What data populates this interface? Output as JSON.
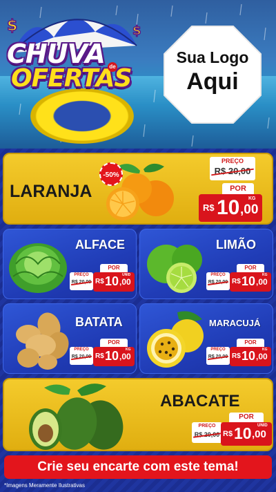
{
  "header": {
    "title_line1": "CHUVA",
    "title_de": "de",
    "title_line2": "OFERTAS",
    "logo_line1": "Sua Logo",
    "logo_line2": "Aqui"
  },
  "products": [
    {
      "name": "LARANJA",
      "discount": "-50%",
      "old_label": "PREÇO",
      "old_price": "R$ 20,00",
      "por_label": "POR",
      "currency": "R$",
      "price_int": "10",
      "price_dec": ",00",
      "unit": "KG"
    },
    {
      "name": "ALFACE",
      "old_label": "PREÇO",
      "old_price": "R$ 20,00",
      "por_label": "POR",
      "currency": "R$",
      "price_int": "10",
      "price_dec": ",00",
      "unit": "UNID"
    },
    {
      "name": "LIMÃO",
      "old_label": "PREÇO",
      "old_price": "R$ 20,00",
      "por_label": "POR",
      "currency": "R$",
      "price_int": "10",
      "price_dec": ",00",
      "unit": "KG"
    },
    {
      "name": "BATATA",
      "old_label": "PREÇO",
      "old_price": "R$ 20,00",
      "por_label": "POR",
      "currency": "R$",
      "price_int": "10",
      "price_dec": ",00",
      "unit": "KG"
    },
    {
      "name": "MARACUJÁ",
      "old_label": "PREÇO",
      "old_price": "R$ 20,00",
      "por_label": "POR",
      "currency": "R$",
      "price_int": "10",
      "price_dec": ",00",
      "unit": "KG"
    },
    {
      "name": "ABACATE",
      "old_label": "PREÇO",
      "old_price": "R$ 20,00",
      "por_label": "POR",
      "currency": "R$",
      "price_int": "10",
      "price_dec": ",00",
      "unit": "UNID"
    }
  ],
  "cta": "Crie seu encarte com este tema!",
  "disclaimer": "*Imagens Meramente Ilustrativas",
  "colors": {
    "accent_red": "#e3151c",
    "card_yellow": "#f4cb2c",
    "card_blue": "#2f56d6",
    "background_blue": "#1a2f8f"
  }
}
